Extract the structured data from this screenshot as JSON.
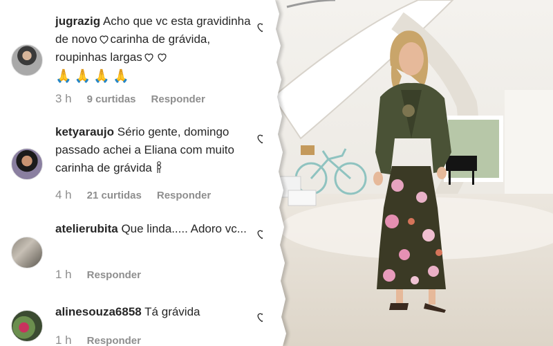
{
  "comments": [
    {
      "username": "jugrazig",
      "text_part1": "Acho que vc esta gravidinha de novo",
      "text_part2": "carinha de grávida, roupinhas largas",
      "extra_icons": "🙏🙏🙏🙏",
      "time": "3 h",
      "likes": "9 curtidas",
      "reply": "Responder"
    },
    {
      "username": "ketyaraujo",
      "text": "Sério gente, domingo passado achei a Eliana com muito carinha de grávida",
      "time": "4 h",
      "likes": "21 curtidas",
      "reply": "Responder"
    },
    {
      "username": "atelierubita",
      "text": "Que linda..... Adoro vc...",
      "time": "1 h",
      "reply": "Responder"
    },
    {
      "username": "alinesouza6858",
      "text": "Tá grávida",
      "time": "1 h",
      "reply": "Responder"
    }
  ],
  "colors": {
    "text": "#262626",
    "meta": "#8e8e8e",
    "background": "#ffffff"
  },
  "icons": [
    "heart-outline-icon",
    "praying-hands-emoji",
    "pregnant-woman-emoji"
  ]
}
